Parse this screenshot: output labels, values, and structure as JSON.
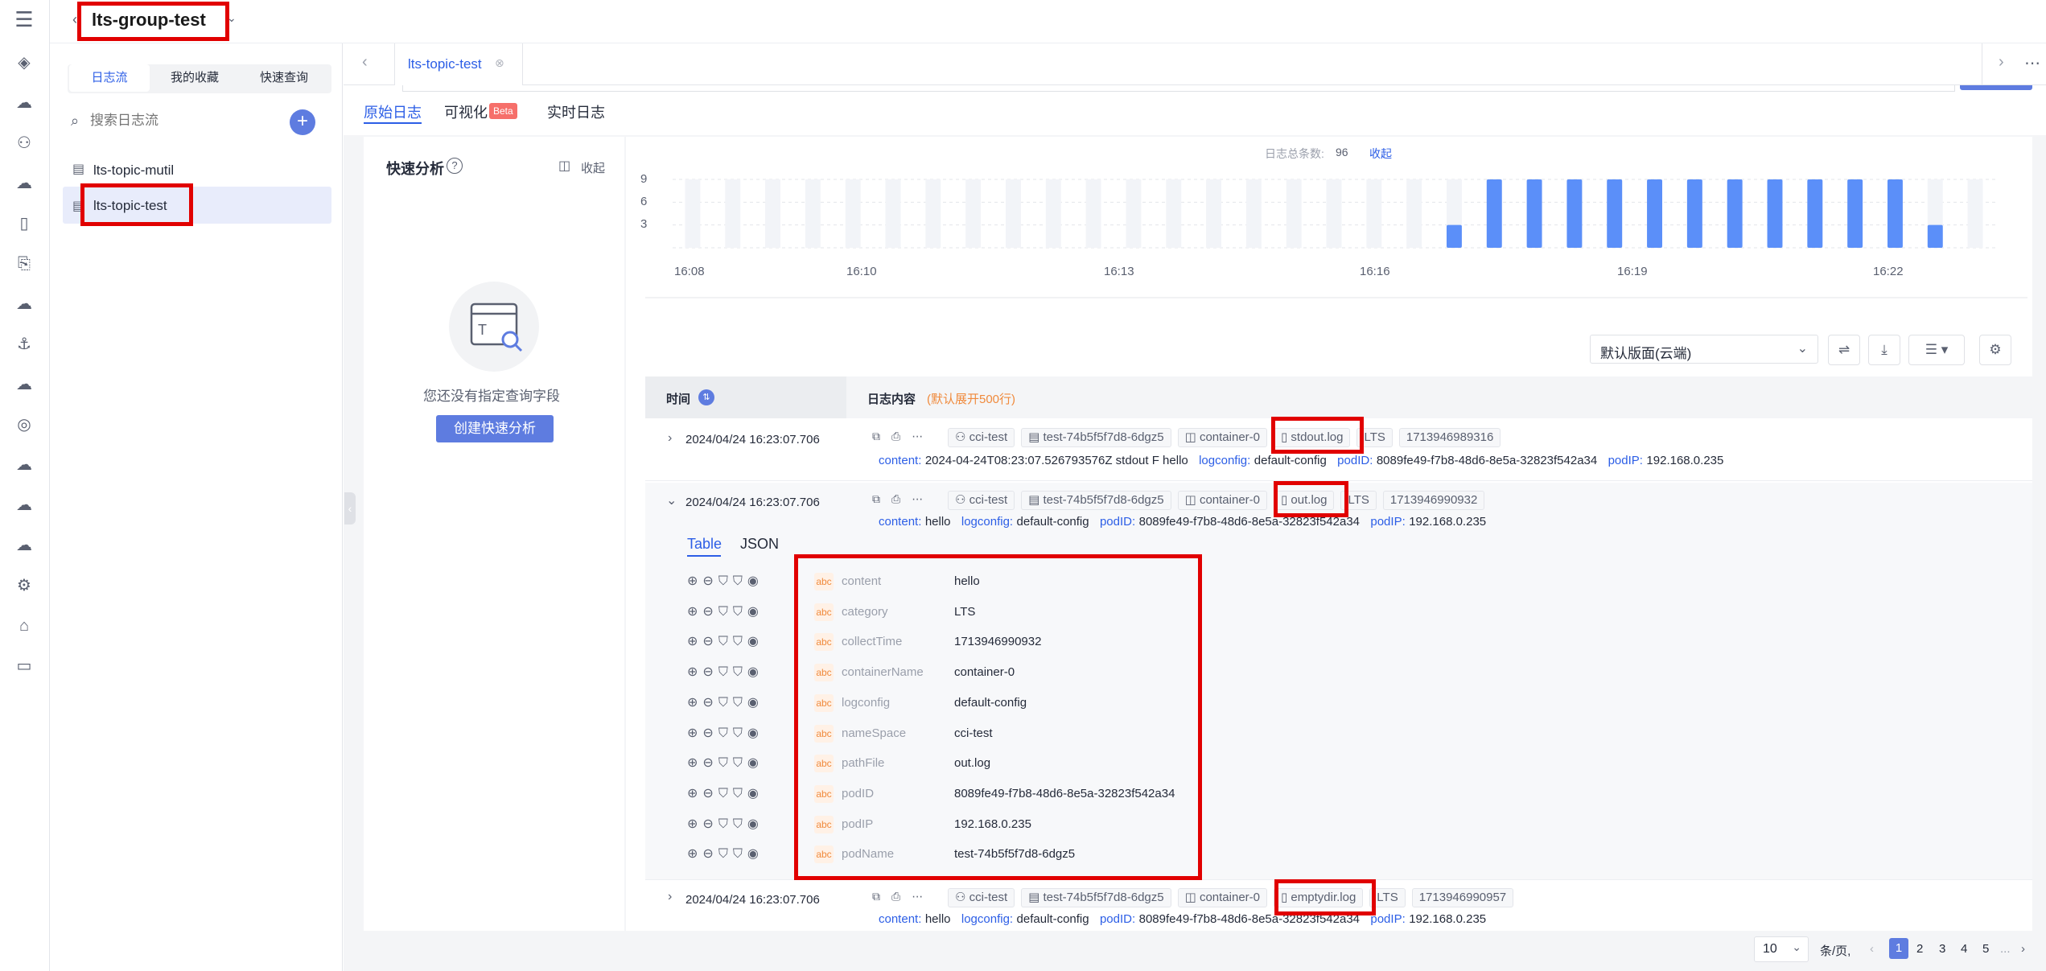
{
  "header": {
    "group_name": "lts-group-test",
    "tab_name": "lts-topic-test"
  },
  "left": {
    "segments": [
      "日志流",
      "我的收藏",
      "快速查询"
    ],
    "search_placeholder": "搜索日志流",
    "streams": [
      "lts-topic-mutil",
      "lts-topic-test"
    ]
  },
  "subtabs": {
    "raw": "原始日志",
    "visual": "可视化",
    "beta": "Beta",
    "realtime": "实时日志"
  },
  "quick": {
    "title": "快速分析",
    "collapse": "收起",
    "empty_text": "您还没有指定查询字段",
    "create_button": "创建快速分析"
  },
  "histogram": {
    "total_label": "日志总条数:",
    "total_value": "96",
    "collapse": "收起",
    "y_ticks": [
      "9",
      "6",
      "3"
    ],
    "x_ticks": [
      "16:08",
      "16:10",
      "16:13",
      "16:16",
      "16:19",
      "16:22"
    ]
  },
  "chart_data": {
    "type": "bar",
    "categories": [
      "16:08",
      "",
      "",
      "",
      "",
      "",
      "",
      "",
      "",
      "",
      "",
      "",
      "",
      "",
      "",
      "",
      "",
      "",
      "",
      "",
      "",
      "",
      "",
      "",
      "",
      "",
      "",
      "",
      "",
      "",
      "",
      "",
      ""
    ],
    "values": [
      0,
      0,
      0,
      0,
      0,
      0,
      0,
      0,
      0,
      0,
      0,
      0,
      0,
      0,
      0,
      0,
      0,
      0,
      0,
      3,
      9,
      9,
      9,
      9,
      9,
      9,
      9,
      9,
      9,
      9,
      9,
      3,
      0
    ],
    "ylim": [
      0,
      9
    ]
  },
  "toolbar": {
    "layout_select": "默认版面(云端)"
  },
  "table": {
    "col_time": "时间",
    "col_content": "日志内容",
    "col_hint": "(默认展开500行)"
  },
  "logs": [
    {
      "time": "2024/04/24 16:23:07.706",
      "expanded": false,
      "tags": [
        "cci-test",
        "test-74b5f5f7d8-6dgz5",
        "container-0",
        "stdout.log",
        "LTS",
        "1713946989316"
      ],
      "content_line": [
        [
          "content:",
          "2024-04-24T08:23:07.526793576Z stdout F hello"
        ],
        [
          "logconfig:",
          "default-config"
        ],
        [
          "podID:",
          "8089fe49-f7b8-48d6-8e5a-32823f542a34"
        ],
        [
          "podIP:",
          "192.168.0.235"
        ]
      ]
    },
    {
      "time": "2024/04/24 16:23:07.706",
      "expanded": true,
      "tags": [
        "cci-test",
        "test-74b5f5f7d8-6dgz5",
        "container-0",
        "out.log",
        "LTS",
        "1713946990932"
      ],
      "content_line": [
        [
          "content:",
          "hello"
        ],
        [
          "logconfig:",
          "default-config"
        ],
        [
          "podID:",
          "8089fe49-f7b8-48d6-8e5a-32823f542a34"
        ],
        [
          "podIP:",
          "192.168.0.235"
        ]
      ]
    },
    {
      "time": "2024/04/24 16:23:07.706",
      "expanded": false,
      "tags": [
        "cci-test",
        "test-74b5f5f7d8-6dgz5",
        "container-0",
        "emptydir.log",
        "LTS",
        "1713946990957"
      ],
      "content_line": [
        [
          "content:",
          "hello"
        ],
        [
          "logconfig:",
          "default-config"
        ],
        [
          "podID:",
          "8089fe49-f7b8-48d6-8e5a-32823f542a34"
        ],
        [
          "podIP:",
          "192.168.0.235"
        ]
      ]
    }
  ],
  "detail": {
    "tabs": [
      "Table",
      "JSON"
    ],
    "type_tag": "abc",
    "fields": [
      [
        "content",
        "hello"
      ],
      [
        "category",
        "LTS"
      ],
      [
        "collectTime",
        "1713946990932"
      ],
      [
        "containerName",
        "container-0"
      ],
      [
        "logconfig",
        "default-config"
      ],
      [
        "nameSpace",
        "cci-test"
      ],
      [
        "pathFile",
        "out.log"
      ],
      [
        "podID",
        "8089fe49-f7b8-48d6-8e5a-32823f542a34"
      ],
      [
        "podIP",
        "192.168.0.235"
      ],
      [
        "podName",
        "test-74b5f5f7d8-6dgz5"
      ]
    ]
  },
  "pagination": {
    "page_size": "10",
    "per_page": "条/页,",
    "pages": [
      "1",
      "2",
      "3",
      "4",
      "5",
      "..."
    ]
  },
  "colors": {
    "accent": "#5e7ce0",
    "bar": "#5b8ff9",
    "highlight": "#e10000"
  }
}
